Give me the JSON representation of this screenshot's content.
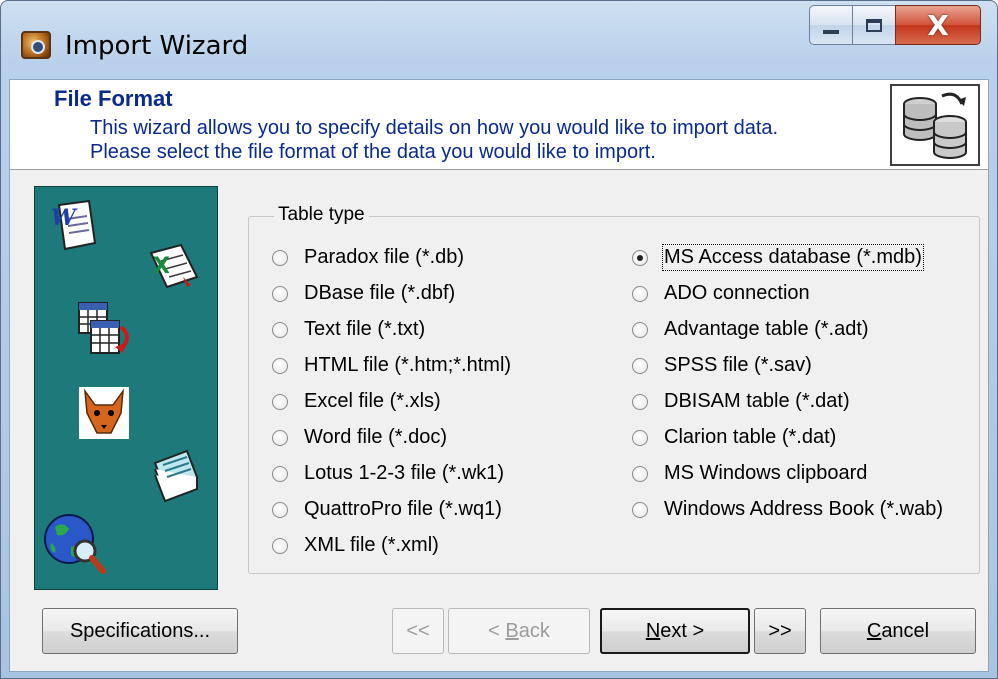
{
  "window": {
    "title": "Import Wizard",
    "close_glyph": "X"
  },
  "header": {
    "title": "File Format",
    "description": "This wizard allows you to specify details on how you would like to import data. Please select the file format of the data you would like to import."
  },
  "group": {
    "label": "Table type",
    "selected": "MS Access database (*.mdb)",
    "left_options": [
      "Paradox file (*.db)",
      "DBase file (*.dbf)",
      "Text file (*.txt)",
      "HTML file (*.htm;*.html)",
      "Excel file (*.xls)",
      "Word file (*.doc)",
      "Lotus 1-2-3 file (*.wk1)",
      "QuattroPro file (*.wq1)",
      "XML file (*.xml)"
    ],
    "right_options": [
      "MS Access database (*.mdb)",
      "ADO connection",
      "Advantage table (*.adt)",
      "SPSS file (*.sav)",
      "DBISAM table (*.dat)",
      "Clarion table (*.dat)",
      "MS Windows clipboard",
      "Windows Address Book (*.wab)"
    ]
  },
  "buttons": {
    "specifications": "Specifications...",
    "first": "<<",
    "back_prefix": "< ",
    "back_mnemonic": "B",
    "back_rest": "ack",
    "next_mnemonic": "N",
    "next_rest": "ext >",
    "last": ">>",
    "cancel_mnemonic": "C",
    "cancel_rest": "ancel"
  },
  "side_icons": [
    "word-document-icon",
    "excel-document-icon",
    "table-import-icon",
    "foxpro-icon",
    "notepad-icon",
    "globe-search-icon"
  ]
}
